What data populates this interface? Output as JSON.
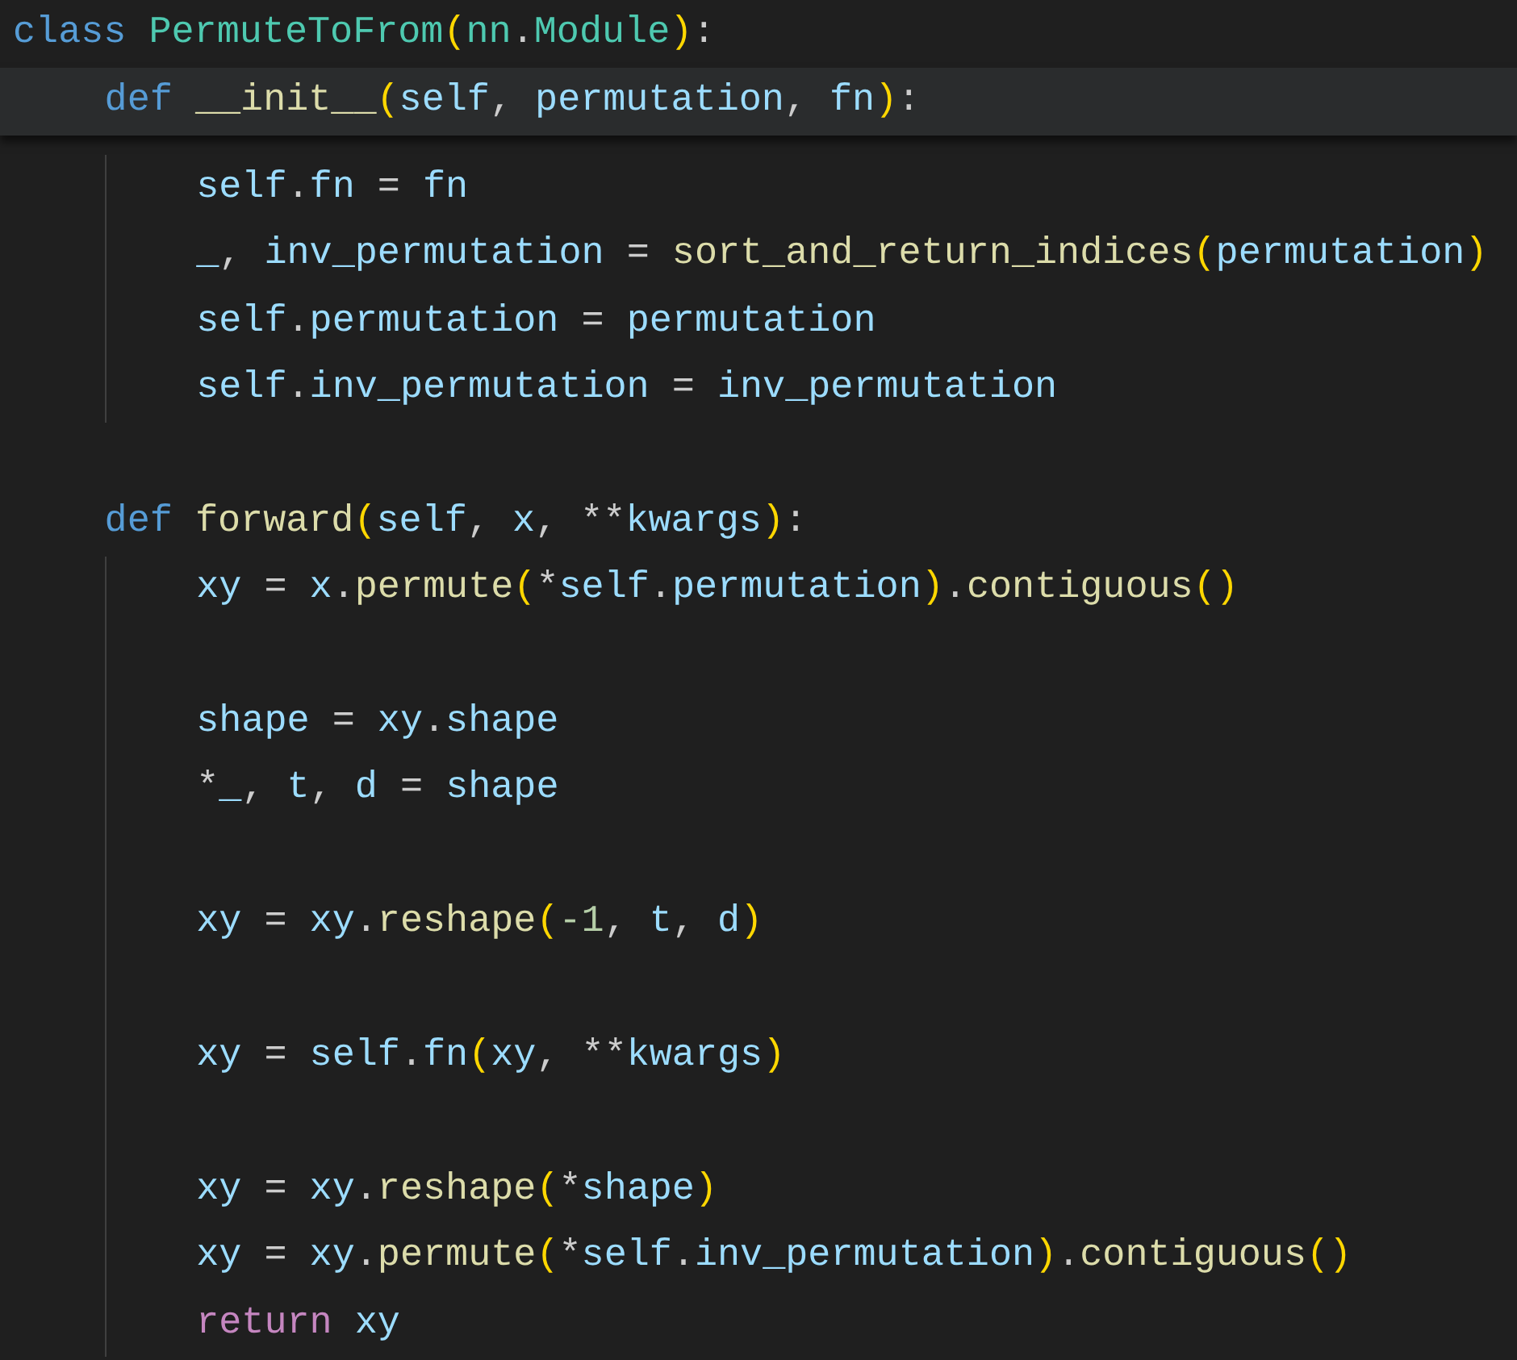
{
  "editor": {
    "lines": [
      {
        "sticky": true,
        "tokens": [
          {
            "text": "class ",
            "kind": "keyword"
          },
          {
            "text": "PermuteToFrom",
            "kind": "type"
          },
          {
            "text": "(",
            "kind": "bracket"
          },
          {
            "text": "nn",
            "kind": "type"
          },
          {
            "text": ".",
            "kind": "op"
          },
          {
            "text": "Module",
            "kind": "type"
          },
          {
            "text": ")",
            "kind": "bracket"
          },
          {
            "text": ":",
            "kind": "op"
          }
        ],
        "children": [
          {
            "sticky": true,
            "tokens": [
              {
                "text": "def ",
                "kind": "keyword"
              },
              {
                "text": "__init__",
                "kind": "func"
              },
              {
                "text": "(",
                "kind": "bracket"
              },
              {
                "text": "self",
                "kind": "var"
              },
              {
                "text": ", ",
                "kind": "op"
              },
              {
                "text": "permutation",
                "kind": "var"
              },
              {
                "text": ", ",
                "kind": "op"
              },
              {
                "text": "fn",
                "kind": "var"
              },
              {
                "text": ")",
                "kind": "bracket"
              },
              {
                "text": ":",
                "kind": "op"
              }
            ],
            "children": [
              {
                "sticky": false,
                "tokens": [
                  {
                    "text": "self",
                    "kind": "var"
                  },
                  {
                    "text": ".",
                    "kind": "op"
                  },
                  {
                    "text": "fn",
                    "kind": "var"
                  },
                  {
                    "text": " = ",
                    "kind": "op"
                  },
                  {
                    "text": "fn",
                    "kind": "var"
                  }
                ]
              },
              {
                "sticky": false,
                "tokens": [
                  {
                    "text": "_",
                    "kind": "var"
                  },
                  {
                    "text": ", ",
                    "kind": "op"
                  },
                  {
                    "text": "inv_permutation",
                    "kind": "var"
                  },
                  {
                    "text": " = ",
                    "kind": "op"
                  },
                  {
                    "text": "sort_and_return_indices",
                    "kind": "func"
                  },
                  {
                    "text": "(",
                    "kind": "bracket"
                  },
                  {
                    "text": "permutation",
                    "kind": "var"
                  },
                  {
                    "text": ")",
                    "kind": "bracket"
                  }
                ]
              },
              {
                "sticky": false,
                "tokens": [
                  {
                    "text": "self",
                    "kind": "var"
                  },
                  {
                    "text": ".",
                    "kind": "op"
                  },
                  {
                    "text": "permutation",
                    "kind": "var"
                  },
                  {
                    "text": " = ",
                    "kind": "op"
                  },
                  {
                    "text": "permutation",
                    "kind": "var"
                  }
                ]
              },
              {
                "sticky": false,
                "tokens": [
                  {
                    "text": "self",
                    "kind": "var"
                  },
                  {
                    "text": ".",
                    "kind": "op"
                  },
                  {
                    "text": "inv_permutation",
                    "kind": "var"
                  },
                  {
                    "text": " = ",
                    "kind": "op"
                  },
                  {
                    "text": "inv_permutation",
                    "kind": "var"
                  }
                ]
              }
            ]
          },
          {
            "kind": "blank"
          },
          {
            "sticky": false,
            "tokens": [
              {
                "text": "def ",
                "kind": "keyword"
              },
              {
                "text": "forward",
                "kind": "func"
              },
              {
                "text": "(",
                "kind": "bracket"
              },
              {
                "text": "self",
                "kind": "var"
              },
              {
                "text": ", ",
                "kind": "op"
              },
              {
                "text": "x",
                "kind": "var"
              },
              {
                "text": ", ",
                "kind": "op"
              },
              {
                "text": "**",
                "kind": "op"
              },
              {
                "text": "kwargs",
                "kind": "var"
              },
              {
                "text": ")",
                "kind": "bracket"
              },
              {
                "text": ":",
                "kind": "op"
              }
            ],
            "children": [
              {
                "sticky": false,
                "tokens": [
                  {
                    "text": "xy",
                    "kind": "var"
                  },
                  {
                    "text": " = ",
                    "kind": "op"
                  },
                  {
                    "text": "x",
                    "kind": "var"
                  },
                  {
                    "text": ".",
                    "kind": "op"
                  },
                  {
                    "text": "permute",
                    "kind": "func"
                  },
                  {
                    "text": "(",
                    "kind": "bracket"
                  },
                  {
                    "text": "*",
                    "kind": "op"
                  },
                  {
                    "text": "self",
                    "kind": "var"
                  },
                  {
                    "text": ".",
                    "kind": "op"
                  },
                  {
                    "text": "permutation",
                    "kind": "var"
                  },
                  {
                    "text": ")",
                    "kind": "bracket"
                  },
                  {
                    "text": ".",
                    "kind": "op"
                  },
                  {
                    "text": "contiguous",
                    "kind": "func"
                  },
                  {
                    "text": "()",
                    "kind": "bracket"
                  }
                ]
              },
              {
                "kind": "blank"
              },
              {
                "sticky": false,
                "tokens": [
                  {
                    "text": "shape",
                    "kind": "var"
                  },
                  {
                    "text": " = ",
                    "kind": "op"
                  },
                  {
                    "text": "xy",
                    "kind": "var"
                  },
                  {
                    "text": ".",
                    "kind": "op"
                  },
                  {
                    "text": "shape",
                    "kind": "var"
                  }
                ]
              },
              {
                "sticky": false,
                "tokens": [
                  {
                    "text": "*",
                    "kind": "op"
                  },
                  {
                    "text": "_",
                    "kind": "var"
                  },
                  {
                    "text": ", ",
                    "kind": "op"
                  },
                  {
                    "text": "t",
                    "kind": "var"
                  },
                  {
                    "text": ", ",
                    "kind": "op"
                  },
                  {
                    "text": "d",
                    "kind": "var"
                  },
                  {
                    "text": " = ",
                    "kind": "op"
                  },
                  {
                    "text": "shape",
                    "kind": "var"
                  }
                ]
              },
              {
                "kind": "blank"
              },
              {
                "sticky": false,
                "tokens": [
                  {
                    "text": "xy",
                    "kind": "var"
                  },
                  {
                    "text": " = ",
                    "kind": "op"
                  },
                  {
                    "text": "xy",
                    "kind": "var"
                  },
                  {
                    "text": ".",
                    "kind": "op"
                  },
                  {
                    "text": "reshape",
                    "kind": "func"
                  },
                  {
                    "text": "(",
                    "kind": "bracket"
                  },
                  {
                    "text": "-1",
                    "kind": "number"
                  },
                  {
                    "text": ", ",
                    "kind": "op"
                  },
                  {
                    "text": "t",
                    "kind": "var"
                  },
                  {
                    "text": ", ",
                    "kind": "op"
                  },
                  {
                    "text": "d",
                    "kind": "var"
                  },
                  {
                    "text": ")",
                    "kind": "bracket"
                  }
                ]
              },
              {
                "kind": "blank"
              },
              {
                "sticky": false,
                "tokens": [
                  {
                    "text": "xy",
                    "kind": "var"
                  },
                  {
                    "text": " = ",
                    "kind": "op"
                  },
                  {
                    "text": "self",
                    "kind": "var"
                  },
                  {
                    "text": ".",
                    "kind": "op"
                  },
                  {
                    "text": "fn",
                    "kind": "var"
                  },
                  {
                    "text": "(",
                    "kind": "bracket"
                  },
                  {
                    "text": "xy",
                    "kind": "var"
                  },
                  {
                    "text": ", ",
                    "kind": "op"
                  },
                  {
                    "text": "**",
                    "kind": "op"
                  },
                  {
                    "text": "kwargs",
                    "kind": "var"
                  },
                  {
                    "text": ")",
                    "kind": "bracket"
                  }
                ]
              },
              {
                "kind": "blank"
              },
              {
                "sticky": false,
                "tokens": [
                  {
                    "text": "xy",
                    "kind": "var"
                  },
                  {
                    "text": " = ",
                    "kind": "op"
                  },
                  {
                    "text": "xy",
                    "kind": "var"
                  },
                  {
                    "text": ".",
                    "kind": "op"
                  },
                  {
                    "text": "reshape",
                    "kind": "func"
                  },
                  {
                    "text": "(",
                    "kind": "bracket"
                  },
                  {
                    "text": "*",
                    "kind": "op"
                  },
                  {
                    "text": "shape",
                    "kind": "var"
                  },
                  {
                    "text": ")",
                    "kind": "bracket"
                  }
                ]
              },
              {
                "sticky": false,
                "tokens": [
                  {
                    "text": "xy",
                    "kind": "var"
                  },
                  {
                    "text": " = ",
                    "kind": "op"
                  },
                  {
                    "text": "xy",
                    "kind": "var"
                  },
                  {
                    "text": ".",
                    "kind": "op"
                  },
                  {
                    "text": "permute",
                    "kind": "func"
                  },
                  {
                    "text": "(",
                    "kind": "bracket"
                  },
                  {
                    "text": "*",
                    "kind": "op"
                  },
                  {
                    "text": "self",
                    "kind": "var"
                  },
                  {
                    "text": ".",
                    "kind": "op"
                  },
                  {
                    "text": "inv_permutation",
                    "kind": "var"
                  },
                  {
                    "text": ")",
                    "kind": "bracket"
                  },
                  {
                    "text": ".",
                    "kind": "op"
                  },
                  {
                    "text": "contiguous",
                    "kind": "func"
                  },
                  {
                    "text": "()",
                    "kind": "bracket"
                  }
                ]
              },
              {
                "sticky": false,
                "tokens": [
                  {
                    "text": "return ",
                    "kind": "control"
                  },
                  {
                    "text": "xy",
                    "kind": "var"
                  }
                ]
              }
            ]
          }
        ]
      }
    ]
  }
}
